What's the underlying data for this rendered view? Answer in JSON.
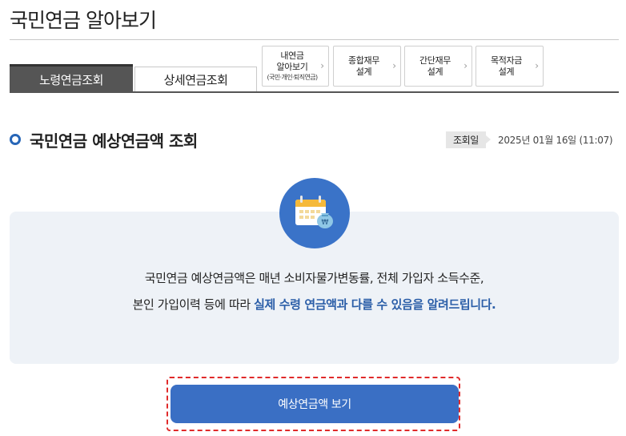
{
  "page": {
    "title": "국민연금 알아보기"
  },
  "tabs": [
    {
      "label": "노령연금조회",
      "active": true
    },
    {
      "label": "상세연금조회",
      "active": false
    }
  ],
  "links": [
    {
      "line1": "내연금",
      "line2": "알아보기",
      "sub": "(국민·개인·퇴직연금)"
    },
    {
      "line1": "종합재무",
      "line2": "설계"
    },
    {
      "line1": "간단재무",
      "line2": "설계"
    },
    {
      "line1": "목적자금",
      "line2": "설계"
    }
  ],
  "section": {
    "title": "국민연금 예상연금액 조회",
    "date_label": "조회일",
    "date_value": "2025년 01월 16일 (11:07)"
  },
  "info": {
    "icon": "calendar-moneybag-icon",
    "line1": "국민연금 예상연금액은 매년 소비자물가변동률, 전체 가입자 소득수준,",
    "line2_plain": "본인 가입이력 등에 따라 ",
    "line2_highlight": "실제 수령 연금액과 다를 수 있음을 알려드립니다."
  },
  "action": {
    "button_label": "예상연금액 보기"
  },
  "colors": {
    "accent": "#3a6fc4",
    "highlight": "#2b5ea8",
    "tab_active": "#555555",
    "outline": "#e02a2a",
    "panel": "#eef2f7"
  }
}
